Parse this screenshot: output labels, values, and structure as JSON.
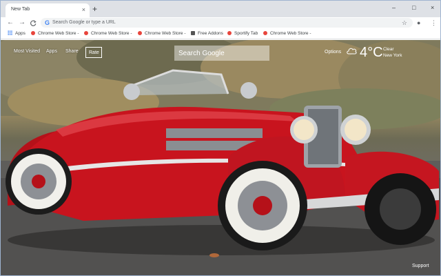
{
  "browser": {
    "tab_title": "New Tab",
    "tab_close": "×",
    "new_tab": "+",
    "window_controls": {
      "minimize": "–",
      "maximize": "□",
      "close": "×"
    }
  },
  "toolbar": {
    "back": "←",
    "forward": "→",
    "reload": "C",
    "omnibox_placeholder": "Search Google or type a URL",
    "star": "☆",
    "profile": "●",
    "menu": "⋮"
  },
  "bookmarks": [
    {
      "label": "Apps",
      "icon": "apps-grid-icon"
    },
    {
      "label": "Chrome Web Store -",
      "icon": "chrome-web-store-icon"
    },
    {
      "label": "Chrome Web Store -",
      "icon": "chrome-web-store-icon"
    },
    {
      "label": "Chrome Web Store -",
      "icon": "chrome-web-store-icon"
    },
    {
      "label": "Free Addons",
      "icon": "addon-icon"
    },
    {
      "label": "Sportify Tab",
      "icon": "chrome-web-store-icon"
    },
    {
      "label": "Chrome Web Store -",
      "icon": "chrome-web-store-icon"
    }
  ],
  "page": {
    "nav": {
      "most_visited": "Most Visited",
      "apps": "Apps",
      "share": "Share",
      "rate": "Rate"
    },
    "search_placeholder": "Search Google",
    "options": "Options",
    "weather": {
      "temperature": "4°C",
      "condition": "Clear",
      "city": "New York",
      "icon": "cloud-icon"
    },
    "support": "Support",
    "background": "classic red roadster car"
  },
  "colors": {
    "car_red": "#c8141e",
    "tab_strip": "#dee1e6"
  }
}
